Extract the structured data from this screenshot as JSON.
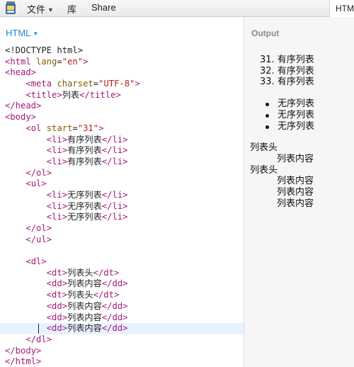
{
  "menubar": {
    "items": [
      {
        "label": "文件",
        "has_caret": true
      },
      {
        "label": "库",
        "has_caret": false
      },
      {
        "label": "Share",
        "has_caret": false
      }
    ],
    "right_tab": "HTM"
  },
  "editor": {
    "language": "HTML",
    "lines": [
      [
        [
          "tx",
          "<!DOCTYPE html>"
        ]
      ],
      [
        [
          "tg",
          "<html"
        ],
        [
          "tx",
          " "
        ],
        [
          "at",
          "lang"
        ],
        [
          "tx",
          "="
        ],
        [
          "st",
          "\"en\""
        ],
        [
          "tg",
          ">"
        ]
      ],
      [
        [
          "tg",
          "<head>"
        ]
      ],
      [
        [
          "tx",
          "    "
        ],
        [
          "tg",
          "<meta"
        ],
        [
          "tx",
          " "
        ],
        [
          "at",
          "charset"
        ],
        [
          "tx",
          "="
        ],
        [
          "st",
          "\"UTF-8\""
        ],
        [
          "tg",
          ">"
        ]
      ],
      [
        [
          "tx",
          "    "
        ],
        [
          "tg",
          "<title>"
        ],
        [
          "tx",
          "列表"
        ],
        [
          "tg",
          "</title>"
        ]
      ],
      [
        [
          "tg",
          "</head>"
        ]
      ],
      [
        [
          "tg",
          "<body>"
        ]
      ],
      [
        [
          "tx",
          "    "
        ],
        [
          "tg",
          "<ol"
        ],
        [
          "tx",
          " "
        ],
        [
          "at",
          "start"
        ],
        [
          "tx",
          "="
        ],
        [
          "st",
          "\"31\""
        ],
        [
          "tg",
          ">"
        ]
      ],
      [
        [
          "tx",
          "        "
        ],
        [
          "tg",
          "<li>"
        ],
        [
          "tx",
          "有序列表"
        ],
        [
          "tg",
          "</li>"
        ]
      ],
      [
        [
          "tx",
          "        "
        ],
        [
          "tg",
          "<li>"
        ],
        [
          "tx",
          "有序列表"
        ],
        [
          "tg",
          "</li>"
        ]
      ],
      [
        [
          "tx",
          "        "
        ],
        [
          "tg",
          "<li>"
        ],
        [
          "tx",
          "有序列表"
        ],
        [
          "tg",
          "</li>"
        ]
      ],
      [
        [
          "tx",
          "    "
        ],
        [
          "tg",
          "</ol>"
        ]
      ],
      [
        [
          "tx",
          "    "
        ],
        [
          "tg",
          "<ul>"
        ]
      ],
      [
        [
          "tx",
          "        "
        ],
        [
          "tg",
          "<li>"
        ],
        [
          "tx",
          "无序列表"
        ],
        [
          "tg",
          "</li>"
        ]
      ],
      [
        [
          "tx",
          "        "
        ],
        [
          "tg",
          "<li>"
        ],
        [
          "tx",
          "无序列表"
        ],
        [
          "tg",
          "</li>"
        ]
      ],
      [
        [
          "tx",
          "        "
        ],
        [
          "tg",
          "<li>"
        ],
        [
          "tx",
          "无序列表"
        ],
        [
          "tg",
          "</li>"
        ]
      ],
      [
        [
          "tx",
          "    "
        ],
        [
          "tg",
          "</ol>"
        ]
      ],
      [
        [
          "tx",
          "    "
        ],
        [
          "tg",
          "</ul>"
        ]
      ],
      [
        [
          "tx",
          ""
        ]
      ],
      [
        [
          "tx",
          "    "
        ],
        [
          "tg",
          "<dl>"
        ]
      ],
      [
        [
          "tx",
          "        "
        ],
        [
          "tg",
          "<dt>"
        ],
        [
          "tx",
          "列表头"
        ],
        [
          "tg",
          "</dt>"
        ]
      ],
      [
        [
          "tx",
          "        "
        ],
        [
          "tg",
          "<dd>"
        ],
        [
          "tx",
          "列表内容"
        ],
        [
          "tg",
          "</dd>"
        ]
      ],
      [
        [
          "tx",
          "        "
        ],
        [
          "tg",
          "<dt>"
        ],
        [
          "tx",
          "列表头"
        ],
        [
          "tg",
          "</dt>"
        ]
      ],
      [
        [
          "tx",
          "        "
        ],
        [
          "tg",
          "<dd>"
        ],
        [
          "tx",
          "列表内容"
        ],
        [
          "tg",
          "</dd>"
        ]
      ],
      [
        [
          "tx",
          "        "
        ],
        [
          "tg",
          "<dd>"
        ],
        [
          "tx",
          "列表内容"
        ],
        [
          "tg",
          "</dd>"
        ]
      ],
      [
        [
          "tx",
          "        "
        ],
        [
          "tg",
          "<dd>"
        ],
        [
          "tx",
          "列表内容"
        ],
        [
          "tg",
          "</dd>"
        ]
      ],
      [
        [
          "tx",
          "    "
        ],
        [
          "tg",
          "</dl>"
        ]
      ],
      [
        [
          "tg",
          "</body>"
        ]
      ],
      [
        [
          "tg",
          "</html>"
        ]
      ]
    ],
    "active_line": 25
  },
  "output": {
    "title": "Output",
    "ordered": {
      "start": 31,
      "items": [
        "有序列表",
        "有序列表",
        "有序列表"
      ]
    },
    "unordered": [
      "无序列表",
      "无序列表",
      "无序列表"
    ],
    "definitions": [
      {
        "term": "列表头",
        "descs": [
          "列表内容"
        ]
      },
      {
        "term": "列表头",
        "descs": [
          "列表内容",
          "列表内容",
          "列表内容"
        ]
      }
    ]
  }
}
